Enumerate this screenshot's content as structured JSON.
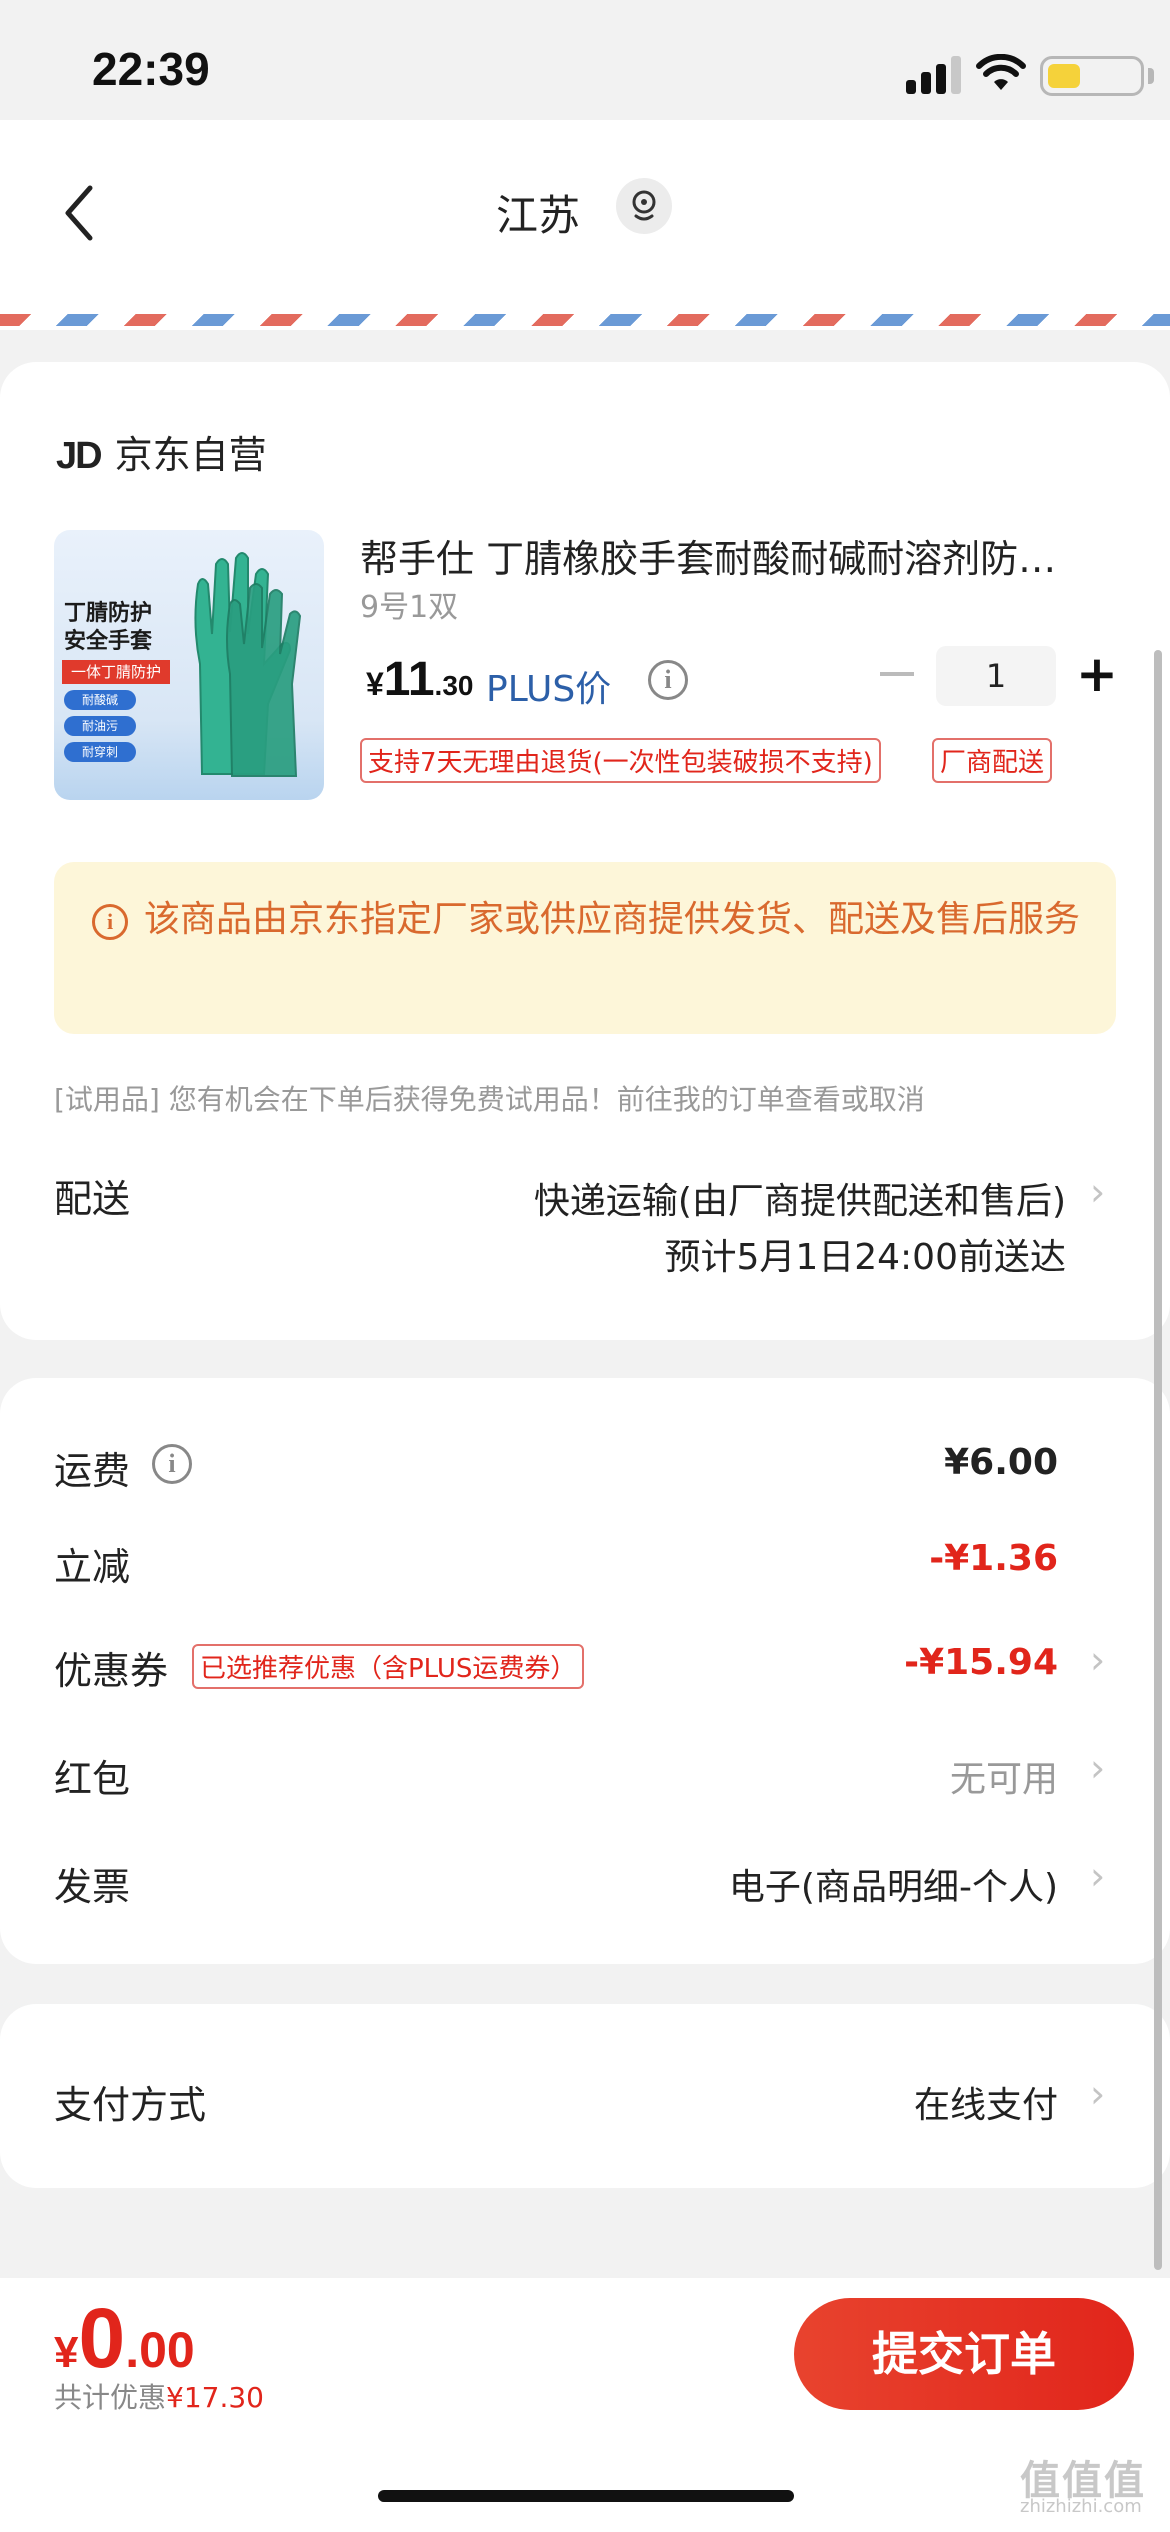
{
  "status_bar": {
    "time": "22:39"
  },
  "header": {
    "title": "江苏"
  },
  "shop": {
    "logo": "JD",
    "name": "京东自营"
  },
  "product": {
    "title": "帮手仕 丁腈橡胶手套耐酸耐碱耐溶剂防…",
    "spec": "9号1双",
    "image_text": {
      "line1": "丁腈防护",
      "line2": "安全手套",
      "banner": "一体丁腈防护",
      "features": [
        "耐酸碱",
        "耐油污",
        "耐穿刺"
      ]
    },
    "price": {
      "symbol": "¥",
      "int": "11",
      "dec": ".30"
    },
    "price_label": "PLUS价",
    "quantity": "1",
    "tags": [
      "支持7天无理由退货(一次性包装破损不支持)",
      "厂商配送"
    ]
  },
  "notice": {
    "text": "该商品由京东指定厂家或供应商提供发货、配送及售后服务"
  },
  "trial": {
    "text": "[试用品] 您有机会在下单后获得免费试用品！前往我的订单查看或取消"
  },
  "delivery": {
    "label": "配送",
    "method": "快递运输(由厂商提供配送和售后)",
    "eta": "预计5月1日24:00前送达"
  },
  "fees": {
    "shipping": {
      "label": "运费",
      "value": "¥6.00"
    },
    "discount": {
      "label": "立减",
      "value": "-¥1.36"
    },
    "coupon": {
      "label": "优惠券",
      "tag": "已选推荐优惠（含PLUS运费券）",
      "value": "-¥15.94"
    },
    "red_packet": {
      "label": "红包",
      "value": "无可用"
    },
    "invoice": {
      "label": "发票",
      "value": "电子(商品明细-个人)"
    }
  },
  "payment": {
    "label": "支付方式",
    "value": "在线支付"
  },
  "footer": {
    "total": {
      "symbol": "¥",
      "int": "0",
      "dec": ".00"
    },
    "saved_label": "共计优惠",
    "saved_value": "¥17.30",
    "submit_label": "提交订单"
  },
  "watermark": {
    "text": "值值值",
    "sub": "zhizhizhi.com"
  },
  "colors": {
    "accent": "#e1251b",
    "notice_bg": "#fdf6d9",
    "notice_text": "#d9692e",
    "plus_blue": "#2c5fa8"
  }
}
